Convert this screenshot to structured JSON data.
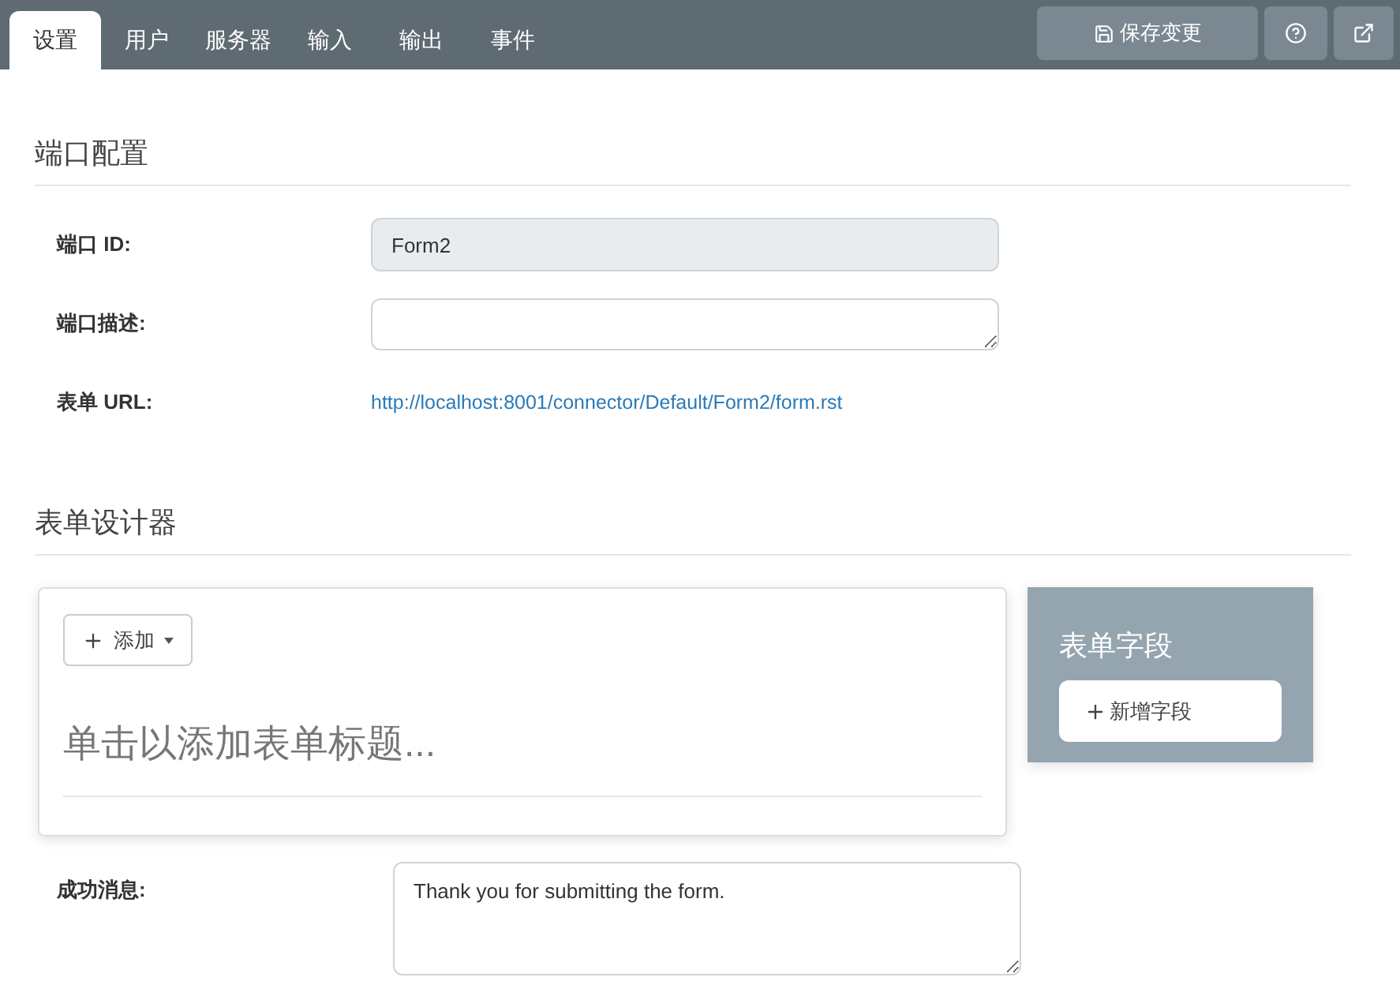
{
  "tabs": [
    {
      "label": "设置",
      "selected": true
    },
    {
      "label": "用户",
      "selected": false
    },
    {
      "label": "服务器",
      "selected": false
    },
    {
      "label": "输入",
      "selected": false
    },
    {
      "label": "输出",
      "selected": false
    },
    {
      "label": "事件",
      "selected": false
    }
  ],
  "toolbar": {
    "save_button": "保存变更"
  },
  "port_config": {
    "title": "端口配置",
    "fields": [
      {
        "kind": "input",
        "label": "端口 ID:",
        "value": "Form2",
        "disabled": true
      },
      {
        "kind": "textarea",
        "label": "端口描述:",
        "disabled": false
      },
      {
        "kind": "link",
        "label": "表单 URL:",
        "value": "http://localhost:8001/connector/Default/Form2/form.rst"
      }
    ]
  },
  "form_designer": {
    "title": "表单设计器",
    "add_button": "添加",
    "form_title_placeholder": "单击以添加表单标题...",
    "fields_panel": {
      "title": "表单字段",
      "add_field_button": "新增字段"
    }
  },
  "success_message": {
    "label": "成功消息:",
    "value": "Thank you for submitting the form."
  }
}
